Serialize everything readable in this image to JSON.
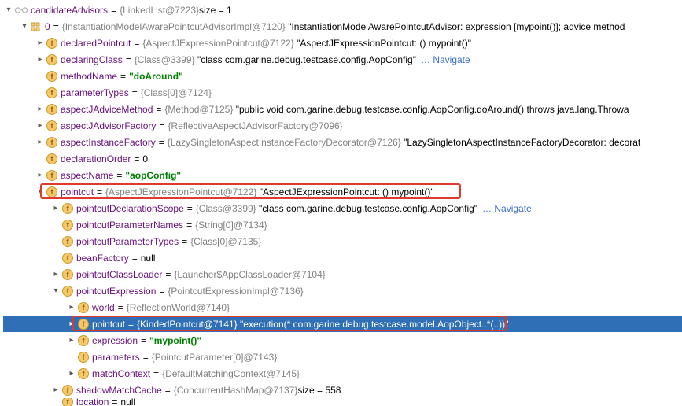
{
  "root": {
    "name": "candidateAdvisors",
    "type": "{LinkedList@7223}",
    "tail": "  size = 1"
  },
  "n0": {
    "name": "0",
    "type": "{InstantiationModelAwarePointcutAdvisorImpl@7120}",
    "quoted": "\"InstantiationModelAwarePointcutAdvisor: expression [mypoint()]; advice method"
  },
  "declaredPointcut": {
    "name": "declaredPointcut",
    "type": "{AspectJExpressionPointcut@7122}",
    "quoted": "\"AspectJExpressionPointcut: () mypoint()\""
  },
  "declaringClass": {
    "name": "declaringClass",
    "type": "{Class@3399}",
    "quoted": "\"class com.garine.debug.testcase.config.AopConfig\"",
    "nav": "… Navigate"
  },
  "methodName": {
    "name": "methodName",
    "value": "\"doAround\""
  },
  "parameterTypes": {
    "name": "parameterTypes",
    "type": "{Class[0]@7124}"
  },
  "aspectJAdviceMethod": {
    "name": "aspectJAdviceMethod",
    "type": "{Method@7125}",
    "quoted": "\"public void com.garine.debug.testcase.config.AopConfig.doAround() throws java.lang.Throwa"
  },
  "aspectJAdvisorFactory": {
    "name": "aspectJAdvisorFactory",
    "type": "{ReflectiveAspectJAdvisorFactory@7096}"
  },
  "aspectInstanceFactory": {
    "name": "aspectInstanceFactory",
    "type": "{LazySingletonAspectInstanceFactoryDecorator@7126}",
    "quoted": "\"LazySingletonAspectInstanceFactoryDecorator: decorat"
  },
  "declarationOrder": {
    "name": "declarationOrder",
    "value": "0"
  },
  "aspectName": {
    "name": "aspectName",
    "value": "\"aopConfig\""
  },
  "pointcut": {
    "name": "pointcut",
    "type": "{AspectJExpressionPointcut@7122}",
    "quoted": "\"AspectJExpressionPointcut: () mypoint()\""
  },
  "pcDeclScope": {
    "name": "pointcutDeclarationScope",
    "type": "{Class@3399}",
    "quoted": "\"class com.garine.debug.testcase.config.AopConfig\"",
    "nav": "… Navigate"
  },
  "pcParamNames": {
    "name": "pointcutParameterNames",
    "type": "{String[0]@7134}"
  },
  "pcParamTypes": {
    "name": "pointcutParameterTypes",
    "type": "{Class[0]@7135}"
  },
  "beanFactory": {
    "name": "beanFactory",
    "value": "null"
  },
  "pcClassLoader": {
    "name": "pointcutClassLoader",
    "type": "{Launcher$AppClassLoader@7104}"
  },
  "pcExpression": {
    "name": "pointcutExpression",
    "type": "{PointcutExpressionImpl@7136}"
  },
  "world": {
    "name": "world",
    "type": "{ReflectionWorld@7140}"
  },
  "innerPointcut": {
    "name": "pointcut",
    "type": "{KindedPointcut@7141}",
    "quoted": "\"execution(* com.garine.debug.testcase.model.AopObject..*(..))\""
  },
  "expression": {
    "name": "expression",
    "value": "\"mypoint()\""
  },
  "parameters": {
    "name": "parameters",
    "type": "{PointcutParameter[0]@7143}"
  },
  "matchContext": {
    "name": "matchContext",
    "type": "{DefaultMatchingContext@7145}"
  },
  "shadowMatchCache": {
    "name": "shadowMatchCache",
    "type": "{ConcurrentHashMap@7137}",
    "tail": "  size = 558"
  },
  "location": {
    "name": "location",
    "value": "null"
  }
}
